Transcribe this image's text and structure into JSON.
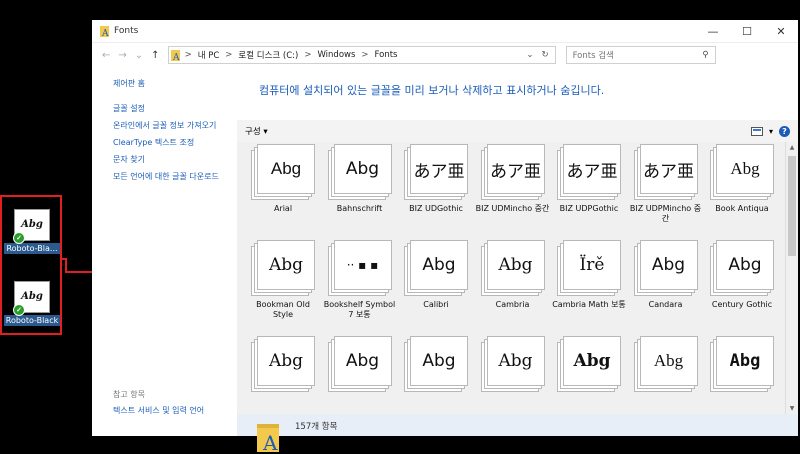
{
  "desktop": {
    "icons": [
      {
        "thumb": "Abg",
        "label": "Roboto-Bla..."
      },
      {
        "thumb": "Abg",
        "label": "Roboto-Black"
      }
    ]
  },
  "window": {
    "title": "Fonts",
    "controls": {
      "minimize": "—",
      "maximize": "☐",
      "close": "✕"
    }
  },
  "address": {
    "nav": {
      "back": "←",
      "forward": "→",
      "recent": "⌄",
      "up": "↑"
    },
    "crumbs": [
      "내 PC",
      "로컬 디스크 (C:)",
      "Windows",
      "Fonts"
    ],
    "separator": ">",
    "dropdown": "⌄",
    "refresh": "↻"
  },
  "search": {
    "placeholder": "Fonts 검색",
    "icon": "search-icon"
  },
  "sidebar": {
    "home": "제어판 홈",
    "links": [
      "글꼴 설정",
      "온라인에서 글꼴 정보 가져오기",
      "ClearType 텍스트 조정",
      "문자 찾기",
      "모든 언어에 대한 글꼴 다운로드"
    ],
    "see_also_heading": "참고 항목",
    "see_also_link": "텍스트 서비스 및 입력 언어"
  },
  "main": {
    "heading": "컴퓨터에 설치되어 있는 글꼴을 미리 보거나 삭제하고 표시하거나 숨깁니다.",
    "organize": "구성 ▾",
    "view_dropdown": "▾",
    "help": "?"
  },
  "fonts": [
    {
      "sample": "Abg",
      "name": "Arial"
    },
    {
      "sample": "Abg",
      "name": "Bahnschrift"
    },
    {
      "sample": "あア亜",
      "name": "BIZ UDGothic"
    },
    {
      "sample": "あア亜",
      "name": "BIZ UDMincho 중간"
    },
    {
      "sample": "あア亜",
      "name": "BIZ UDPGothic"
    },
    {
      "sample": "あア亜",
      "name": "BIZ UDPMincho 중간"
    },
    {
      "sample": "Abg",
      "name": "Book Antiqua"
    },
    {
      "sample": "Abg",
      "name": "Bookman Old Style"
    },
    {
      "sample": "·· ▪ ▪",
      "name": "Bookshelf Symbol 7 보통"
    },
    {
      "sample": "Abg",
      "name": "Calibri"
    },
    {
      "sample": "Abg",
      "name": "Cambria"
    },
    {
      "sample": "Ïrě",
      "name": "Cambria Math 보통"
    },
    {
      "sample": "Abg",
      "name": "Candara"
    },
    {
      "sample": "Abg",
      "name": "Century Gothic"
    },
    {
      "sample": "Abg",
      "name": ""
    },
    {
      "sample": "Abg",
      "name": ""
    },
    {
      "sample": "Abg",
      "name": ""
    },
    {
      "sample": "Abg",
      "name": ""
    },
    {
      "sample": "Abg",
      "name": ""
    },
    {
      "sample": "Abg",
      "name": ""
    },
    {
      "sample": "Abg",
      "name": ""
    }
  ],
  "status": {
    "count": "157개 항목"
  },
  "colors": {
    "accent": "#1b5cb8",
    "highlight_box": "#e02020",
    "status_bg": "#e8eef8"
  }
}
